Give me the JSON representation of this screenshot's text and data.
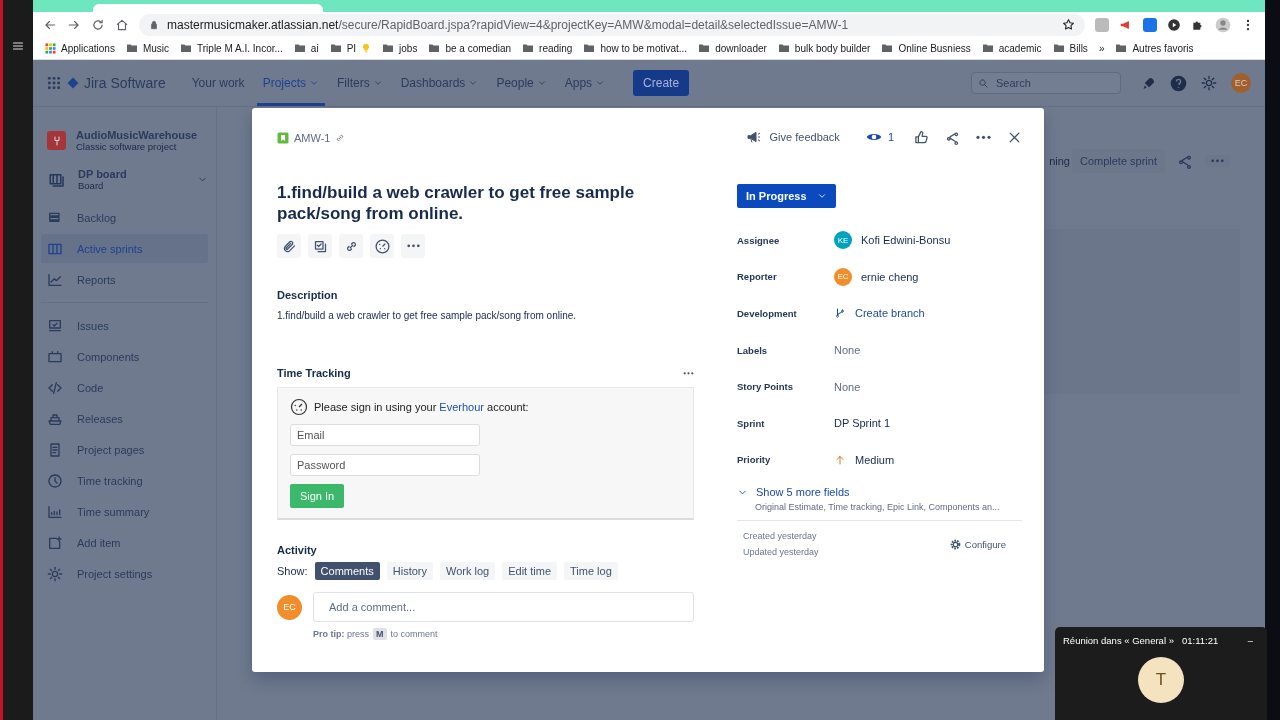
{
  "browser": {
    "url_host": "mastermusicmaker.atlassian.net",
    "url_path": "/secure/RapidBoard.jspa?rapidView=4&projectKey=AMW&modal=detail&selectedIssue=AMW-1",
    "bookmarks": [
      {
        "label": "Applications",
        "kind": "apps"
      },
      {
        "label": "Music",
        "kind": "folder"
      },
      {
        "label": "Triple M A.I. Incor...",
        "kind": "folder"
      },
      {
        "label": "ai",
        "kind": "folder"
      },
      {
        "label": "PI",
        "kind": "folder-bulb"
      },
      {
        "label": "jobs",
        "kind": "folder"
      },
      {
        "label": "be a comedian",
        "kind": "folder"
      },
      {
        "label": "reading",
        "kind": "folder"
      },
      {
        "label": "how to be motivat...",
        "kind": "folder"
      },
      {
        "label": "downloader",
        "kind": "folder"
      },
      {
        "label": "bulk body builder",
        "kind": "folder"
      },
      {
        "label": "Online Busniess",
        "kind": "folder"
      },
      {
        "label": "academic",
        "kind": "folder"
      },
      {
        "label": "Bills",
        "kind": "folder"
      },
      {
        "label": "»",
        "kind": "more"
      },
      {
        "label": "Autres favoris",
        "kind": "folder"
      }
    ]
  },
  "app": {
    "product": "Jira Software",
    "nav": [
      {
        "label": "Your work",
        "dropdown": false,
        "selected": false
      },
      {
        "label": "Projects",
        "dropdown": true,
        "selected": true
      },
      {
        "label": "Filters",
        "dropdown": true,
        "selected": false
      },
      {
        "label": "Dashboards",
        "dropdown": true,
        "selected": false
      },
      {
        "label": "People",
        "dropdown": true,
        "selected": false
      },
      {
        "label": "Apps",
        "dropdown": true,
        "selected": false
      }
    ],
    "create_button": "Create",
    "search": {
      "placeholder": "Search"
    },
    "user_initials": "EC"
  },
  "sidebar": {
    "project": {
      "name": "AudioMusicWarehouse",
      "subtitle": "Classic software project"
    },
    "board": {
      "name": "DP board",
      "subtitle": "Board"
    },
    "groups": [
      [
        {
          "label": "Backlog",
          "selected": false
        },
        {
          "label": "Active sprints",
          "selected": true
        },
        {
          "label": "Reports",
          "selected": false
        }
      ],
      [
        {
          "label": "Issues",
          "selected": false
        },
        {
          "label": "Components",
          "selected": false
        },
        {
          "label": "Code",
          "selected": false
        },
        {
          "label": "Releases",
          "selected": false
        },
        {
          "label": "Project pages",
          "selected": false
        },
        {
          "label": "Time tracking",
          "selected": false
        },
        {
          "label": "Time summary",
          "selected": false
        },
        {
          "label": "Add item",
          "selected": false
        },
        {
          "label": "Project settings",
          "selected": false
        }
      ]
    ]
  },
  "board_header": {
    "partial_text": "ning",
    "complete_button": "Complete sprint"
  },
  "issue": {
    "key": "AMW-1",
    "title": "1.find/build a web crawler to get free sample pack/song from online.",
    "description_label": "Description",
    "description": "1.find/build a web crawler to get free sample pack/song from online.",
    "time_tracking": {
      "title": "Time Tracking",
      "message": "Please sign in using your",
      "link": "Everhour",
      "message_end": "account:",
      "email_placeholder": "Email",
      "password_placeholder": "Password",
      "button": "Sign In"
    },
    "activity": {
      "title": "Activity",
      "show_label": "Show:",
      "filters": [
        {
          "label": "Comments",
          "selected": true
        },
        {
          "label": "History",
          "selected": false
        },
        {
          "label": "Work log",
          "selected": false
        },
        {
          "label": "Edit time",
          "selected": false
        },
        {
          "label": "Time log",
          "selected": false
        }
      ],
      "avatar_initials": "EC",
      "comment_placeholder": "Add a comment...",
      "pro_tip": {
        "label": "Pro tip:",
        "before": "press",
        "key": "M",
        "after": "to comment"
      }
    },
    "feedback": "Give feedback",
    "watchers": "1",
    "status": "In Progress",
    "fields": [
      {
        "label": "Assignee",
        "kind": "avatar",
        "value": "Kofi Edwini-Bonsu",
        "initials": "KE",
        "color": "#00a3bf"
      },
      {
        "label": "Reporter",
        "kind": "avatar",
        "value": "ernie cheng",
        "initials": "EC",
        "color": "#f18d2a"
      },
      {
        "label": "Development",
        "kind": "branch",
        "value": "Create branch"
      },
      {
        "label": "Labels",
        "kind": "none",
        "value": "None"
      },
      {
        "label": "Story Points",
        "kind": "none",
        "value": "None"
      },
      {
        "label": "Sprint",
        "kind": "text",
        "value": "DP Sprint 1"
      },
      {
        "label": "Priority",
        "kind": "priority",
        "value": "Medium"
      }
    ],
    "more_fields": {
      "label": "Show 5 more fields",
      "summary": "Original Estimate, Time tracking, Epic Link, Components an..."
    },
    "created": "Created yesterday",
    "updated": "Updated yesterday",
    "configure": "Configure"
  },
  "meeting": {
    "title": "Réunion dans « General »",
    "time": "01:11:21",
    "minimize": "–",
    "avatar_initial": "T"
  }
}
